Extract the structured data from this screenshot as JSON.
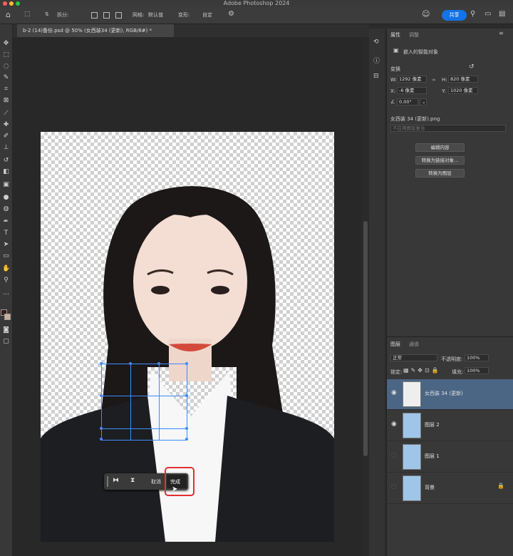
{
  "app": {
    "title": "Adobe Photoshop 2024"
  },
  "options": {
    "split_label": "拆分:",
    "grid_label": "网格:",
    "grid_value": "默认值",
    "deform_label": "变形:",
    "deform_value": "自定",
    "share": "共享"
  },
  "document": {
    "tab_title": "b-2 (14)备份.psd @ 50% (女西装34 (更新), RGB/8#) *"
  },
  "context_bar": {
    "cancel": "取消",
    "done": "完成"
  },
  "properties": {
    "tab_properties": "属性",
    "tab_adjust": "调整",
    "type": "嵌入的智能对象",
    "transform_label": "变换",
    "w_label": "W:",
    "w_value": "1292 像素",
    "h_label": "H:",
    "h_value": "820 像素",
    "x_label": "X:",
    "x_value": "-6 像素",
    "y_label": "Y:",
    "y_value": "1020 像素",
    "angle_value": "0.00°",
    "filename": "女西装 34 (更新).png",
    "comp_placeholder": "不应用图层复合",
    "btn_edit": "编辑内容",
    "btn_link": "转换为链接对象...",
    "btn_layers": "转换为图层"
  },
  "layers_panel": {
    "tab_layers": "图层",
    "tab_channels": "通道",
    "blend_mode": "正常",
    "opacity_label": "不透明度:",
    "opacity_value": "100%",
    "lock_label": "锁定:",
    "fill_label": "填充:",
    "fill_value": "100%",
    "layers": [
      {
        "name": "女西装 34 (更新)",
        "visible": true,
        "selected": true
      },
      {
        "name": "图层 2",
        "visible": true,
        "selected": false
      },
      {
        "name": "图层 1",
        "visible": false,
        "selected": false
      },
      {
        "name": "背景",
        "visible": false,
        "selected": false,
        "locked": true
      }
    ]
  },
  "colors": {
    "accent": "#1473e6",
    "highlight": "#e52e2e",
    "selected_layer": "#4b6585"
  }
}
